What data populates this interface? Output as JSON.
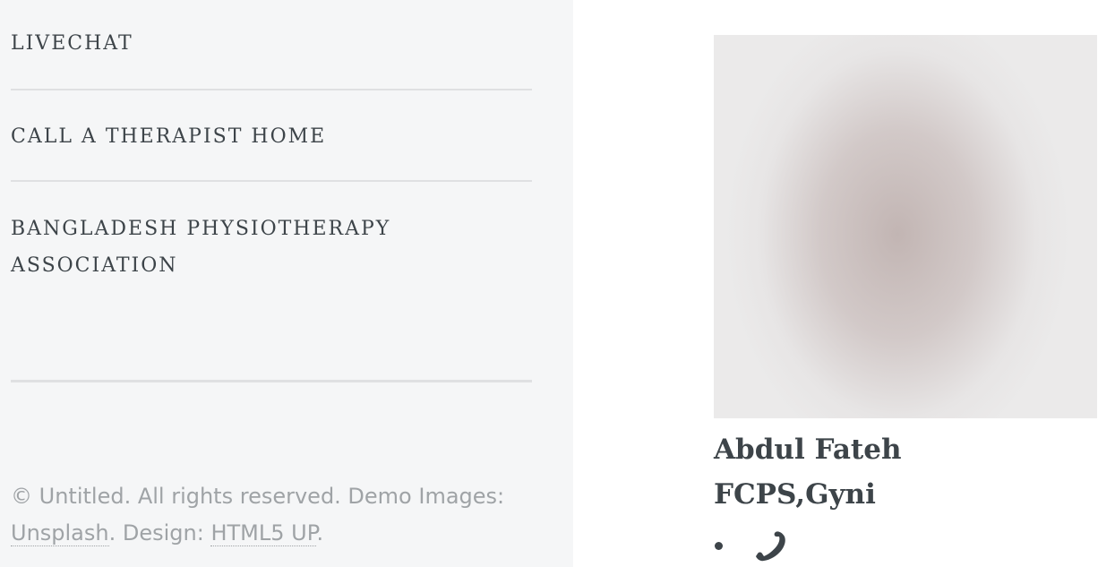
{
  "sidebar": {
    "menu": [
      {
        "label": "LIVECHAT"
      },
      {
        "label": "CALL A THERAPIST HOME"
      },
      {
        "label": "BANGLADESH PHYSIOTHERAPY ASSOCIATION"
      }
    ],
    "footer": {
      "copyright": "© Untitled. All rights reserved. Demo Images: ",
      "unsplash_link": "Unsplash",
      "design_text": ". Design: ",
      "html5up_link": "HTML5 UP",
      "end": "."
    }
  },
  "profile": {
    "name": "Abdul Fateh",
    "degree": "FCPS,Gyni",
    "contact_icon": "phone-icon"
  },
  "colors": {
    "sidebar_bg": "#f5f6f7",
    "text": "#3d4449",
    "muted": "#9fa3a6"
  }
}
